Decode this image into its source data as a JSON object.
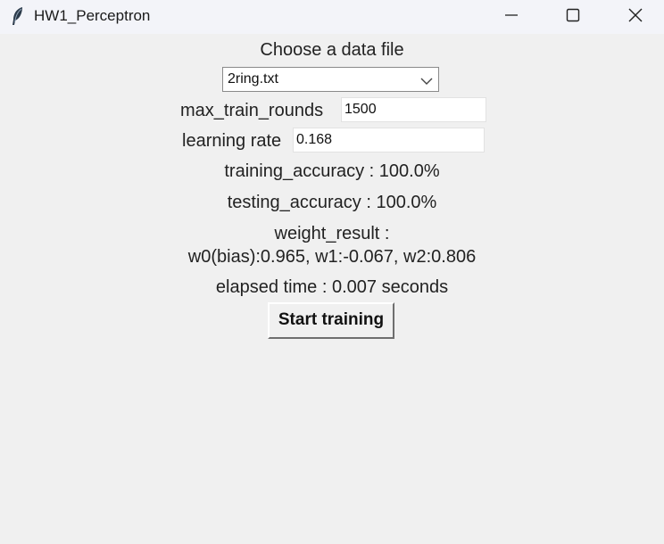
{
  "window": {
    "title": "HW1_Perceptron",
    "icon": "feather-icon"
  },
  "form": {
    "choose_label": "Choose a data file",
    "file_select_value": "2ring.txt",
    "max_rounds_label": "max_train_rounds",
    "max_rounds_value": "1500",
    "learning_rate_label": "learning rate",
    "learning_rate_value": "0.168"
  },
  "results": {
    "training_accuracy": "training_accuracy : 100.0%",
    "testing_accuracy": "testing_accuracy : 100.0%",
    "weight_label": "weight_result :",
    "weight_values": "w0(bias):0.965, w1:-0.067, w2:0.806",
    "elapsed": "elapsed time : 0.007 seconds"
  },
  "actions": {
    "start_label": "Start training"
  }
}
